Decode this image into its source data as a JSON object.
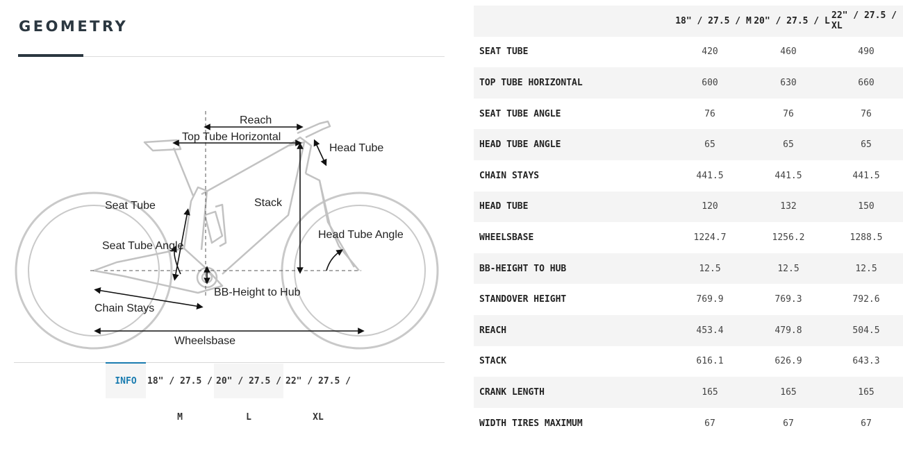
{
  "header": {
    "title": "GEOMETRY"
  },
  "diagram": {
    "labels": {
      "reach": "Reach",
      "top_tube_horizontal": "Top Tube Horizontal",
      "head_tube": "Head Tube",
      "seat_tube": "Seat Tube",
      "stack": "Stack",
      "head_tube_angle": "Head Tube Angle",
      "seat_tube_angle": "Seat Tube Angle",
      "bb_height_to_hub": "BB-Height to Hub",
      "chain_stays": "Chain Stays",
      "wheelsbase": "Wheelsbase"
    }
  },
  "tabs": [
    {
      "label": "INFO",
      "active": true
    },
    {
      "label": "18\" / 27.5 / M",
      "active": false
    },
    {
      "label": "20\" / 27.5 / L",
      "active": false
    },
    {
      "label": "22\" / 27.5 / XL",
      "active": false
    }
  ],
  "table": {
    "columns": [
      "18\" / 27.5 / M",
      "20\" / 27.5 / L",
      "22\" / 27.5 / XL"
    ],
    "rows": [
      {
        "label": "SEAT TUBE",
        "values": [
          "420",
          "460",
          "490"
        ]
      },
      {
        "label": "TOP TUBE HORIZONTAL",
        "values": [
          "600",
          "630",
          "660"
        ]
      },
      {
        "label": "SEAT TUBE ANGLE",
        "values": [
          "76",
          "76",
          "76"
        ]
      },
      {
        "label": "HEAD TUBE ANGLE",
        "values": [
          "65",
          "65",
          "65"
        ]
      },
      {
        "label": "CHAIN STAYS",
        "values": [
          "441.5",
          "441.5",
          "441.5"
        ]
      },
      {
        "label": "HEAD TUBE",
        "values": [
          "120",
          "132",
          "150"
        ]
      },
      {
        "label": "WHEELSBASE",
        "values": [
          "1224.7",
          "1256.2",
          "1288.5"
        ]
      },
      {
        "label": "BB-HEIGHT TO HUB",
        "values": [
          "12.5",
          "12.5",
          "12.5"
        ]
      },
      {
        "label": "STANDOVER HEIGHT",
        "values": [
          "769.9",
          "769.3",
          "792.6"
        ]
      },
      {
        "label": "REACH",
        "values": [
          "453.4",
          "479.8",
          "504.5"
        ]
      },
      {
        "label": "STACK",
        "values": [
          "616.1",
          "626.9",
          "643.3"
        ]
      },
      {
        "label": "CRANK LENGTH",
        "values": [
          "165",
          "165",
          "165"
        ]
      },
      {
        "label": "WIDTH TIRES MAXIMUM",
        "values": [
          "67",
          "67",
          "67"
        ]
      }
    ]
  },
  "colors": {
    "accent": "#1a7cb0",
    "title": "#2b3740",
    "row_shade": "#f4f4f4"
  }
}
